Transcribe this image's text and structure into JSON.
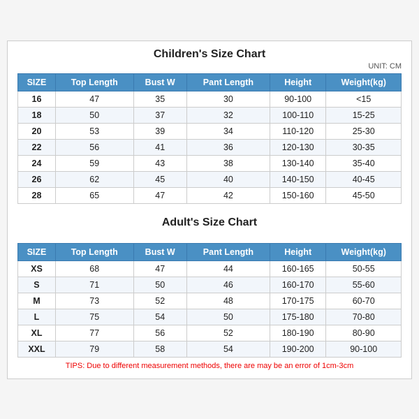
{
  "unit": "UNIT: CM",
  "children_title": "Children's Size Chart",
  "adults_title": "Adult's Size Chart",
  "columns": [
    "SIZE",
    "Top Length",
    "Bust W",
    "Pant Length",
    "Height",
    "Weight(kg)"
  ],
  "children_rows": [
    [
      "16",
      "47",
      "35",
      "30",
      "90-100",
      "<15"
    ],
    [
      "18",
      "50",
      "37",
      "32",
      "100-110",
      "15-25"
    ],
    [
      "20",
      "53",
      "39",
      "34",
      "110-120",
      "25-30"
    ],
    [
      "22",
      "56",
      "41",
      "36",
      "120-130",
      "30-35"
    ],
    [
      "24",
      "59",
      "43",
      "38",
      "130-140",
      "35-40"
    ],
    [
      "26",
      "62",
      "45",
      "40",
      "140-150",
      "40-45"
    ],
    [
      "28",
      "65",
      "47",
      "42",
      "150-160",
      "45-50"
    ]
  ],
  "adult_rows": [
    [
      "XS",
      "68",
      "47",
      "44",
      "160-165",
      "50-55"
    ],
    [
      "S",
      "71",
      "50",
      "46",
      "160-170",
      "55-60"
    ],
    [
      "M",
      "73",
      "52",
      "48",
      "170-175",
      "60-70"
    ],
    [
      "L",
      "75",
      "54",
      "50",
      "175-180",
      "70-80"
    ],
    [
      "XL",
      "77",
      "56",
      "52",
      "180-190",
      "80-90"
    ],
    [
      "XXL",
      "79",
      "58",
      "54",
      "190-200",
      "90-100"
    ]
  ],
  "tips": "TIPS: Due to different measurement methods, there are may be an error of 1cm-3cm"
}
